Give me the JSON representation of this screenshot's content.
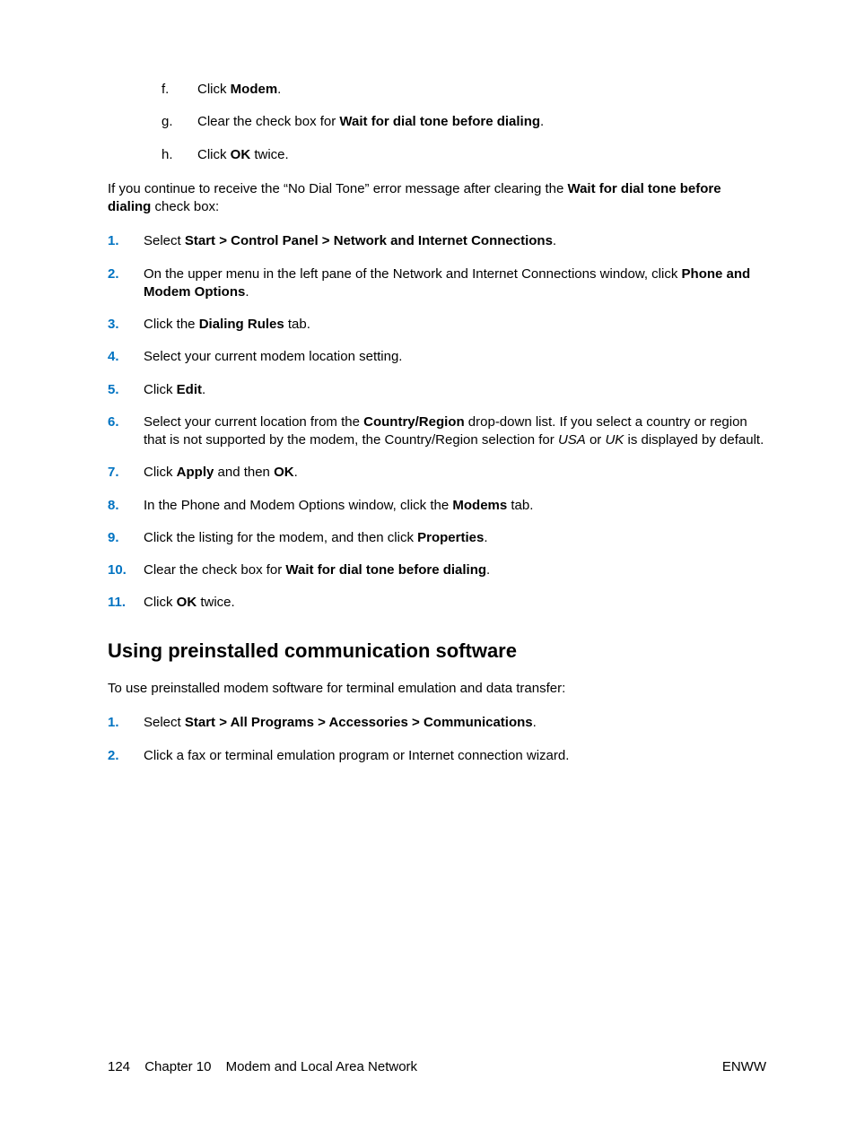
{
  "alpha_list": [
    {
      "marker": "f.",
      "segments": [
        {
          "t": "Click "
        },
        {
          "t": "Modem",
          "b": true
        },
        {
          "t": "."
        }
      ]
    },
    {
      "marker": "g.",
      "segments": [
        {
          "t": "Clear the check box for "
        },
        {
          "t": "Wait for dial tone before dialing",
          "b": true
        },
        {
          "t": "."
        }
      ]
    },
    {
      "marker": "h.",
      "segments": [
        {
          "t": "Click "
        },
        {
          "t": "OK",
          "b": true
        },
        {
          "t": " twice."
        }
      ]
    }
  ],
  "paragraph_after_alpha": [
    {
      "t": "If you continue to receive the “No Dial Tone” error message after clearing the "
    },
    {
      "t": "Wait for dial tone before dialing",
      "b": true
    },
    {
      "t": " check box:"
    }
  ],
  "num_list_1": [
    {
      "marker": "1.",
      "segments": [
        {
          "t": "Select "
        },
        {
          "t": "Start > Control Panel > Network and Internet Connections",
          "b": true
        },
        {
          "t": "."
        }
      ]
    },
    {
      "marker": "2.",
      "segments": [
        {
          "t": "On the upper menu in the left pane of the Network and Internet Connections window, click "
        },
        {
          "t": "Phone and Modem Options",
          "b": true
        },
        {
          "t": "."
        }
      ]
    },
    {
      "marker": "3.",
      "segments": [
        {
          "t": "Click the "
        },
        {
          "t": "Dialing Rules",
          "b": true
        },
        {
          "t": " tab."
        }
      ]
    },
    {
      "marker": "4.",
      "segments": [
        {
          "t": "Select your current modem location setting."
        }
      ]
    },
    {
      "marker": "5.",
      "segments": [
        {
          "t": "Click "
        },
        {
          "t": "Edit",
          "b": true
        },
        {
          "t": "."
        }
      ]
    },
    {
      "marker": "6.",
      "segments": [
        {
          "t": "Select your current location from the "
        },
        {
          "t": "Country/Region",
          "b": true
        },
        {
          "t": " drop-down list. If you select a country or region that is not supported by the modem, the Country/Region selection for "
        },
        {
          "t": "USA",
          "i": true
        },
        {
          "t": " or "
        },
        {
          "t": "UK",
          "i": true
        },
        {
          "t": " is displayed by default."
        }
      ]
    },
    {
      "marker": "7.",
      "segments": [
        {
          "t": "Click "
        },
        {
          "t": "Apply",
          "b": true
        },
        {
          "t": " and then "
        },
        {
          "t": "OK",
          "b": true
        },
        {
          "t": "."
        }
      ]
    },
    {
      "marker": "8.",
      "segments": [
        {
          "t": "In the Phone and Modem Options window, click the "
        },
        {
          "t": "Modems",
          "b": true
        },
        {
          "t": " tab."
        }
      ]
    },
    {
      "marker": "9.",
      "segments": [
        {
          "t": "Click the listing for the modem, and then click "
        },
        {
          "t": "Properties",
          "b": true
        },
        {
          "t": "."
        }
      ]
    },
    {
      "marker": "10.",
      "segments": [
        {
          "t": "Clear the check box for "
        },
        {
          "t": "Wait for dial tone before dialing",
          "b": true
        },
        {
          "t": "."
        }
      ]
    },
    {
      "marker": "11.",
      "segments": [
        {
          "t": "Click "
        },
        {
          "t": "OK",
          "b": true
        },
        {
          "t": " twice."
        }
      ]
    }
  ],
  "section_heading": "Using preinstalled communication software",
  "section_intro": "To use preinstalled modem software for terminal emulation and data transfer:",
  "num_list_2": [
    {
      "marker": "1.",
      "segments": [
        {
          "t": "Select "
        },
        {
          "t": "Start > All Programs > Accessories > Communications",
          "b": true
        },
        {
          "t": "."
        }
      ]
    },
    {
      "marker": "2.",
      "segments": [
        {
          "t": "Click a fax or terminal emulation program or Internet connection wizard."
        }
      ]
    }
  ],
  "footer": {
    "page_number": "124",
    "chapter": "Chapter 10",
    "chapter_title": "Modem and Local Area Network",
    "right": "ENWW"
  }
}
